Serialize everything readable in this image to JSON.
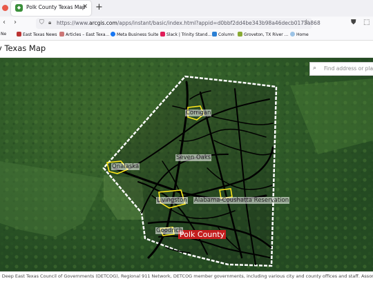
{
  "browser": {
    "tab_title": "Polk County Texas Map",
    "tab_favicon": "map-icon",
    "url_prefix": "https://www.",
    "url_domain": "arcgis.com",
    "url_rest": "/apps/instant/basic/index.html?appid=d0bbf2dd4be343b98a46decb0173a868"
  },
  "bookmarks": [
    {
      "label": "Ne",
      "icon": "bookmark-icon"
    },
    {
      "label": "East Texas News",
      "icon": "bookmark-icon"
    },
    {
      "label": "Articles – East Texa...",
      "icon": "bookmark-icon"
    },
    {
      "label": "Meta Business Suite",
      "icon": "meta-icon"
    },
    {
      "label": "Slack | Trinity Stand...",
      "icon": "slack-icon"
    },
    {
      "label": "Column",
      "icon": "bookmark-icon"
    },
    {
      "label": "Groveton, TX River ...",
      "icon": "bookmark-icon"
    },
    {
      "label": "Home",
      "icon": "cloud-icon"
    }
  ],
  "app": {
    "title": "y Texas Map"
  },
  "map": {
    "search_placeholder": "Find address or place",
    "county_label": "Polk County",
    "places": [
      {
        "name": "Corrigan"
      },
      {
        "name": "Seven Oaks"
      },
      {
        "name": "Onalaska"
      },
      {
        "name": "Livingston"
      },
      {
        "name": "Alabama-Coushatta Reservation"
      },
      {
        "name": "Goodrich"
      }
    ]
  },
  "attribution": "p) Deep East Texas Council of Governments (DETCOG), Regional 911 Network, DETCOG member governments, including various city and county offices and staff. Assorted federal, state, and co",
  "colors": {
    "county_label_bg": "#c41e1e",
    "boundary": "#ffffff",
    "roads": "#000000",
    "city_outline": "#ffe81a"
  }
}
